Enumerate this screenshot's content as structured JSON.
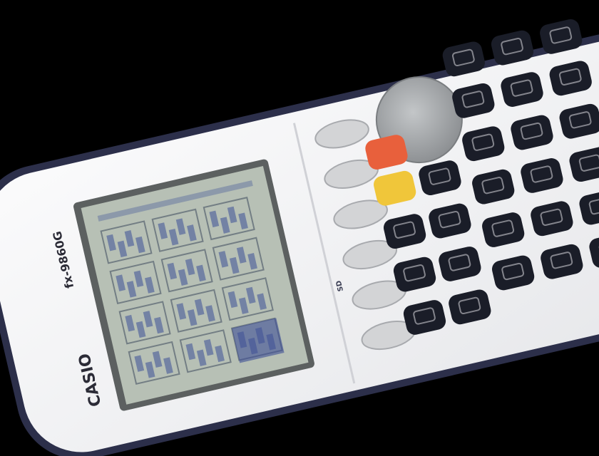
{
  "calculator": {
    "brand": "CASIO",
    "model": "fx-9860G",
    "subtitle": "SD"
  },
  "colors": {
    "backdrop": "#000000",
    "body": "#f4f4f6",
    "rim": "#2c2f4a",
    "lcd": "#b7c0b5",
    "lcd_ink": "#3d4f96",
    "dpad": "#9ea1a4",
    "key_dark": "#1a1d28",
    "key_light": "#d3d4d6",
    "key_yellow": "#f0c63a",
    "key_orange": "#e8603c"
  },
  "icons": {
    "replay_pad": "dpad-icon",
    "function_keys": "softkey-icon"
  }
}
